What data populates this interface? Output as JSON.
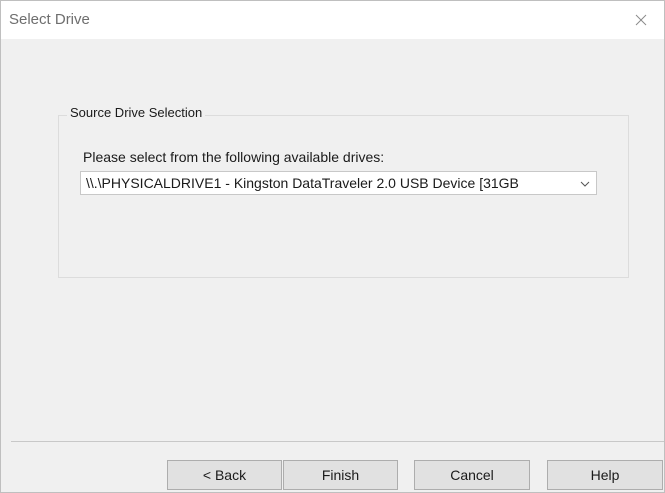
{
  "window": {
    "title": "Select Drive"
  },
  "group": {
    "legend": "Source Drive Selection",
    "prompt": "Please select from the following available drives:",
    "drive_select": {
      "selected": "\\\\.\\PHYSICALDRIVE1 - Kingston DataTraveler 2.0 USB Device [31GB"
    }
  },
  "buttons": {
    "back": "< Back",
    "finish": "Finish",
    "cancel": "Cancel",
    "help": "Help"
  },
  "icons": {
    "close": "close-icon",
    "dropdown": "chevron-down-icon"
  }
}
